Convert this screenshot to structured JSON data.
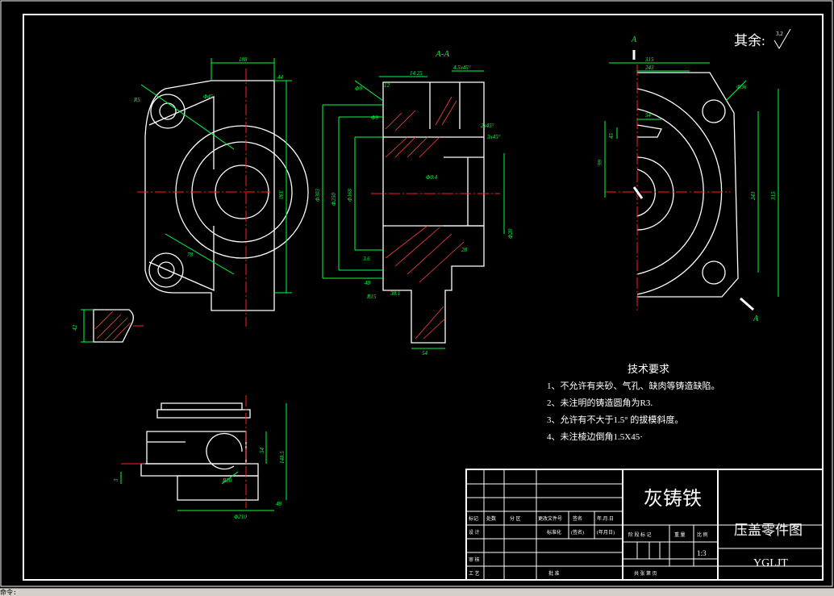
{
  "drawing": {
    "section_title": "A-A",
    "roughness_note": "其余:",
    "roughness_value": "3.2",
    "section_marks": [
      "A",
      "A"
    ],
    "tech_requirements": {
      "title": "技术要求",
      "items": [
        "1、不允许有夹砂、气孔、缺肉等铸造缺陷。",
        "2、未注明的铸造圆角为R3.",
        "3、允许有不大于1.5° 的拔模斜度。",
        "4、未注棱边倒角1.5X45·"
      ]
    },
    "title_block": {
      "material": "灰铸铁",
      "drawing_name": "压盖零件图",
      "drawing_code": "YGLJT",
      "scale": "1:3",
      "row_labels": [
        "标记",
        "处数",
        "分 区",
        "更改文件号",
        "签名",
        "年.月.日"
      ],
      "design_label": "设 计",
      "standard_label": "标准化",
      "sign_label": "(签名)",
      "date_label": "(年月日)",
      "stage_label": "阶 段 标 记",
      "weight_label": "重 量",
      "scale_label": "比 例",
      "review_label": "审 核",
      "process_label": "工 艺",
      "approve_label": "批 准",
      "sheet_label": "共  张  第  页"
    },
    "dims_left": [
      "188",
      "44",
      "330",
      "Φ45",
      "R5",
      "78",
      "42"
    ],
    "dims_section": [
      "Φ303",
      "Φ250",
      "Φ168",
      "Φ9",
      "Φ9",
      "12",
      "14.25",
      "4.5x45°",
      "2x45°",
      "3x45°",
      "Φ0.4",
      "28",
      "3.6",
      "48",
      "38.1",
      "R15",
      "54",
      "Φ20"
    ],
    "dims_right": [
      "315",
      "243",
      "Φ36",
      "54",
      "45",
      "99",
      "243",
      "315"
    ],
    "dims_bottom": [
      "148.5",
      "54",
      "3",
      "Φ210",
      "R20",
      "48"
    ]
  },
  "status_strip": "命令:"
}
